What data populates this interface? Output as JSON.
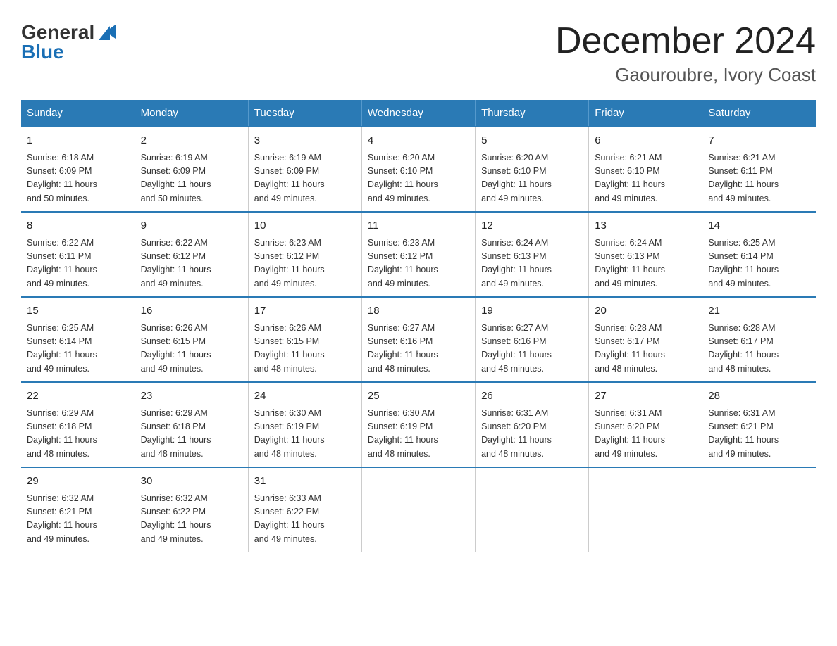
{
  "logo": {
    "general": "General",
    "blue": "Blue",
    "icon": "▶"
  },
  "title": "December 2024",
  "subtitle": "Gaouroubre, Ivory Coast",
  "headers": [
    "Sunday",
    "Monday",
    "Tuesday",
    "Wednesday",
    "Thursday",
    "Friday",
    "Saturday"
  ],
  "weeks": [
    [
      {
        "day": "1",
        "sunrise": "6:18 AM",
        "sunset": "6:09 PM",
        "daylight": "11 hours and 50 minutes."
      },
      {
        "day": "2",
        "sunrise": "6:19 AM",
        "sunset": "6:09 PM",
        "daylight": "11 hours and 50 minutes."
      },
      {
        "day": "3",
        "sunrise": "6:19 AM",
        "sunset": "6:09 PM",
        "daylight": "11 hours and 49 minutes."
      },
      {
        "day": "4",
        "sunrise": "6:20 AM",
        "sunset": "6:10 PM",
        "daylight": "11 hours and 49 minutes."
      },
      {
        "day": "5",
        "sunrise": "6:20 AM",
        "sunset": "6:10 PM",
        "daylight": "11 hours and 49 minutes."
      },
      {
        "day": "6",
        "sunrise": "6:21 AM",
        "sunset": "6:10 PM",
        "daylight": "11 hours and 49 minutes."
      },
      {
        "day": "7",
        "sunrise": "6:21 AM",
        "sunset": "6:11 PM",
        "daylight": "11 hours and 49 minutes."
      }
    ],
    [
      {
        "day": "8",
        "sunrise": "6:22 AM",
        "sunset": "6:11 PM",
        "daylight": "11 hours and 49 minutes."
      },
      {
        "day": "9",
        "sunrise": "6:22 AM",
        "sunset": "6:12 PM",
        "daylight": "11 hours and 49 minutes."
      },
      {
        "day": "10",
        "sunrise": "6:23 AM",
        "sunset": "6:12 PM",
        "daylight": "11 hours and 49 minutes."
      },
      {
        "day": "11",
        "sunrise": "6:23 AM",
        "sunset": "6:12 PM",
        "daylight": "11 hours and 49 minutes."
      },
      {
        "day": "12",
        "sunrise": "6:24 AM",
        "sunset": "6:13 PM",
        "daylight": "11 hours and 49 minutes."
      },
      {
        "day": "13",
        "sunrise": "6:24 AM",
        "sunset": "6:13 PM",
        "daylight": "11 hours and 49 minutes."
      },
      {
        "day": "14",
        "sunrise": "6:25 AM",
        "sunset": "6:14 PM",
        "daylight": "11 hours and 49 minutes."
      }
    ],
    [
      {
        "day": "15",
        "sunrise": "6:25 AM",
        "sunset": "6:14 PM",
        "daylight": "11 hours and 49 minutes."
      },
      {
        "day": "16",
        "sunrise": "6:26 AM",
        "sunset": "6:15 PM",
        "daylight": "11 hours and 49 minutes."
      },
      {
        "day": "17",
        "sunrise": "6:26 AM",
        "sunset": "6:15 PM",
        "daylight": "11 hours and 48 minutes."
      },
      {
        "day": "18",
        "sunrise": "6:27 AM",
        "sunset": "6:16 PM",
        "daylight": "11 hours and 48 minutes."
      },
      {
        "day": "19",
        "sunrise": "6:27 AM",
        "sunset": "6:16 PM",
        "daylight": "11 hours and 48 minutes."
      },
      {
        "day": "20",
        "sunrise": "6:28 AM",
        "sunset": "6:17 PM",
        "daylight": "11 hours and 48 minutes."
      },
      {
        "day": "21",
        "sunrise": "6:28 AM",
        "sunset": "6:17 PM",
        "daylight": "11 hours and 48 minutes."
      }
    ],
    [
      {
        "day": "22",
        "sunrise": "6:29 AM",
        "sunset": "6:18 PM",
        "daylight": "11 hours and 48 minutes."
      },
      {
        "day": "23",
        "sunrise": "6:29 AM",
        "sunset": "6:18 PM",
        "daylight": "11 hours and 48 minutes."
      },
      {
        "day": "24",
        "sunrise": "6:30 AM",
        "sunset": "6:19 PM",
        "daylight": "11 hours and 48 minutes."
      },
      {
        "day": "25",
        "sunrise": "6:30 AM",
        "sunset": "6:19 PM",
        "daylight": "11 hours and 48 minutes."
      },
      {
        "day": "26",
        "sunrise": "6:31 AM",
        "sunset": "6:20 PM",
        "daylight": "11 hours and 48 minutes."
      },
      {
        "day": "27",
        "sunrise": "6:31 AM",
        "sunset": "6:20 PM",
        "daylight": "11 hours and 49 minutes."
      },
      {
        "day": "28",
        "sunrise": "6:31 AM",
        "sunset": "6:21 PM",
        "daylight": "11 hours and 49 minutes."
      }
    ],
    [
      {
        "day": "29",
        "sunrise": "6:32 AM",
        "sunset": "6:21 PM",
        "daylight": "11 hours and 49 minutes."
      },
      {
        "day": "30",
        "sunrise": "6:32 AM",
        "sunset": "6:22 PM",
        "daylight": "11 hours and 49 minutes."
      },
      {
        "day": "31",
        "sunrise": "6:33 AM",
        "sunset": "6:22 PM",
        "daylight": "11 hours and 49 minutes."
      },
      null,
      null,
      null,
      null
    ]
  ],
  "labels": {
    "sunrise": "Sunrise:",
    "sunset": "Sunset:",
    "daylight": "Daylight:"
  }
}
